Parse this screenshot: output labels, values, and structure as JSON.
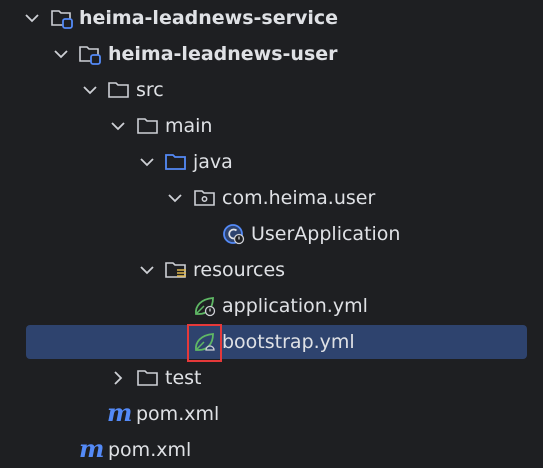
{
  "tree": {
    "items": [
      {
        "label": "heima-leadnews-service",
        "icon": "module-folder-icon",
        "expanded": true
      },
      {
        "label": "heima-leadnews-user",
        "icon": "module-folder-icon",
        "expanded": true
      },
      {
        "label": "src",
        "icon": "folder-icon",
        "expanded": true
      },
      {
        "label": "main",
        "icon": "folder-icon",
        "expanded": true
      },
      {
        "label": "java",
        "icon": "source-root-folder-icon",
        "expanded": true
      },
      {
        "label": "com.heima.user",
        "icon": "package-icon",
        "expanded": true
      },
      {
        "label": "UserApplication",
        "icon": "spring-boot-class-icon"
      },
      {
        "label": "resources",
        "icon": "resources-folder-icon",
        "expanded": true
      },
      {
        "label": "application.yml",
        "icon": "spring-config-icon"
      },
      {
        "label": "bootstrap.yml",
        "icon": "spring-bootstrap-icon",
        "selected": true
      },
      {
        "label": "test",
        "icon": "folder-icon",
        "expanded": false
      },
      {
        "label": "pom.xml",
        "icon": "maven-icon",
        "glyph": "m"
      },
      {
        "label": "pom.xml",
        "icon": "maven-icon",
        "glyph": "m"
      }
    ]
  },
  "colors": {
    "background": "#1e1f22",
    "selection": "#2e436e",
    "text": "#dfe1e5",
    "folder_stroke": "#ced0d6",
    "source_root": "#548af7",
    "spring_green": "#5fb865",
    "highlight_box": "#e5393a"
  }
}
